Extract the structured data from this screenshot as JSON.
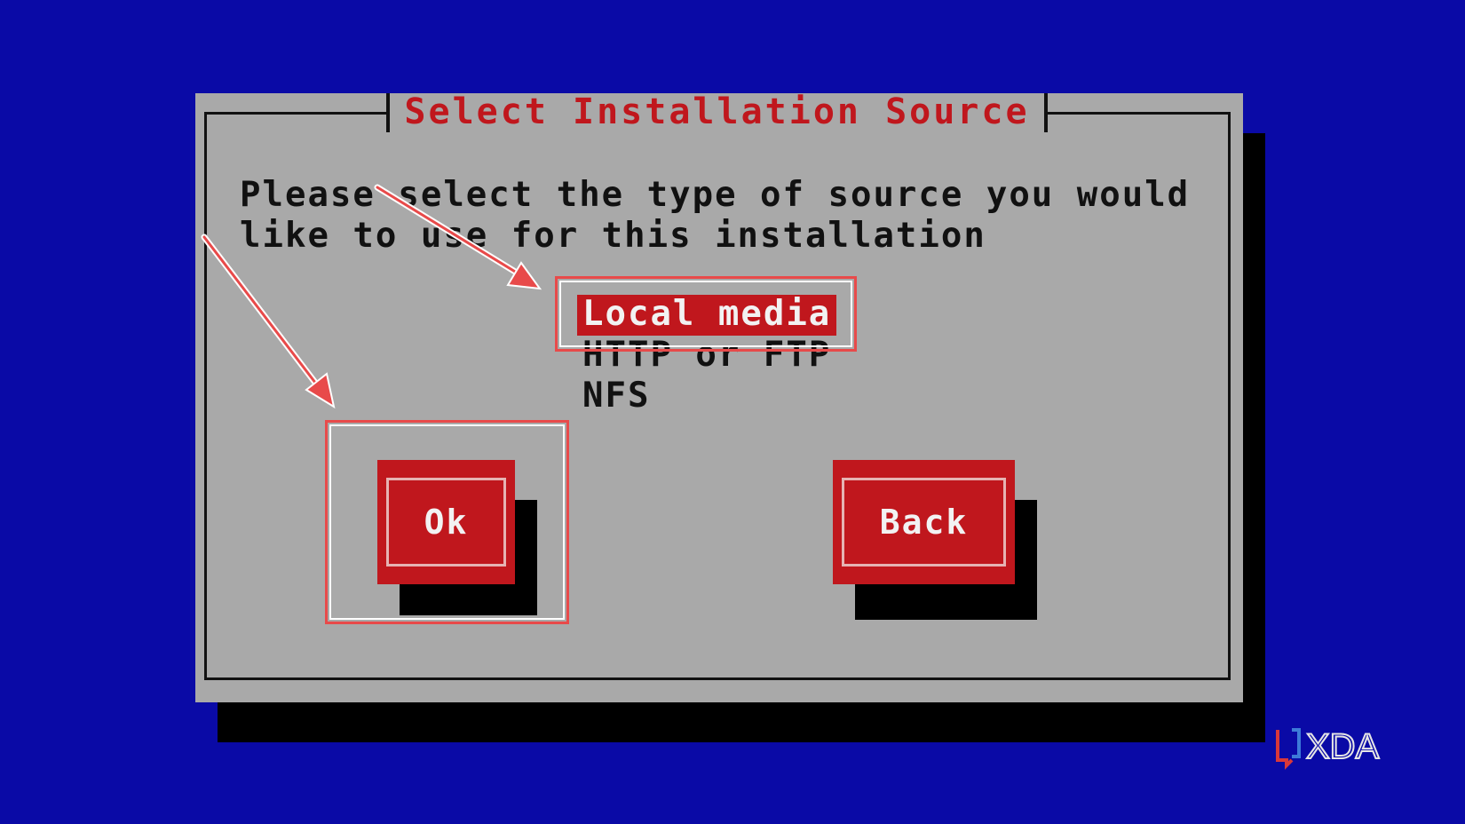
{
  "dialog": {
    "title": "Select Installation Source",
    "prompt": "Please select the type of source you would\nlike to use for this installation",
    "sources": [
      {
        "label": "Local media",
        "selected": true
      },
      {
        "label": "HTTP or FTP",
        "selected": false
      },
      {
        "label": "NFS",
        "selected": false
      }
    ],
    "buttons": {
      "ok": "Ok",
      "back": "Back"
    }
  },
  "colors": {
    "background": "#0a0aa6",
    "dialog": "#a9a9a9",
    "accent": "#c0171d",
    "annotation": "#e84a4a"
  },
  "logo": {
    "text": "XDA"
  }
}
